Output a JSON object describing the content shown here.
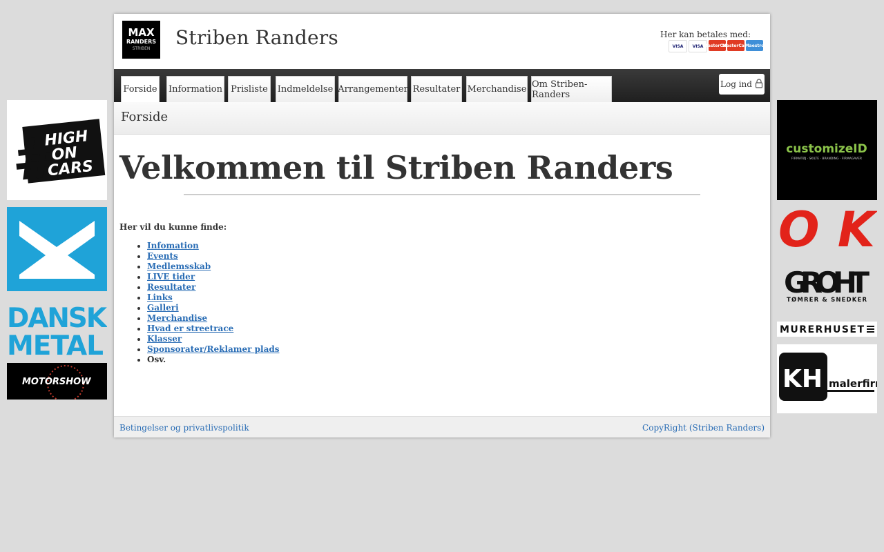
{
  "site": {
    "title": "Striben Randers",
    "logo_text": [
      "MAX",
      "RANDERS",
      "STRIBEN"
    ]
  },
  "payment": {
    "label": "Her kan betales med:",
    "cards": [
      {
        "name": "VISA",
        "bg": "#ffffff",
        "fg": "#1a1f71"
      },
      {
        "name": "VISA",
        "bg": "#ffffff",
        "fg": "#1a1f71"
      },
      {
        "name": "MasterCard",
        "bg": "#e03b24",
        "fg": "#ffffff"
      },
      {
        "name": "MasterCard",
        "bg": "#e03b24",
        "fg": "#ffffff"
      },
      {
        "name": "Maestro",
        "bg": "#3f8fd8",
        "fg": "#ffffff"
      }
    ]
  },
  "nav": {
    "tabs": [
      "Forside",
      "Information",
      "Prisliste",
      "Indmeldelse",
      "Arrangementer",
      "Resultater",
      "Merchandise",
      "Om Striben-Randers"
    ],
    "active": "Forside",
    "login_label": "Log ind",
    "login_icon": "lock-icon"
  },
  "breadcrumb": "Forside",
  "main": {
    "headline": "Velkommen til Striben Randers",
    "intro": "Her vil du kunne finde:",
    "links": [
      "Infomation",
      "Events",
      "Medlemsskab",
      "LIVE tider",
      "Resultater",
      "Links",
      "Galleri",
      "Merchandise",
      "Hvad er streetrace",
      "Klasser",
      "Sponsorater/Reklamer plads"
    ],
    "last_item": "Osv."
  },
  "footer": {
    "left_link": "Betingelser og privatlivspolitik",
    "right_link": "CopyRight (Striben Randers)"
  },
  "sponsors": {
    "left": [
      {
        "name": "high-on-cars",
        "lines": [
          "HIGH",
          "ON",
          "CARS"
        ],
        "bg": "#ffffff"
      },
      {
        "name": "dansk-metal",
        "lines": [
          "DANSK",
          "METAL"
        ],
        "color": "#1fa3d8"
      },
      {
        "name": "motorshow",
        "text": "MOTORSHOW",
        "bg": "#000000"
      }
    ],
    "right": [
      {
        "name": "customize-id",
        "text": "customizeID",
        "sub": "FIRMATØJ · SKILTE · BRANDING · FIRMAGAVER",
        "color": "#8bc34a"
      },
      {
        "name": "ok",
        "text": "OK",
        "color": "#e2231a"
      },
      {
        "name": "groht",
        "text": "GROHT",
        "sub": "TØMRER & SNEDKER"
      },
      {
        "name": "murerhuset",
        "text": "MURERHUSET"
      },
      {
        "name": "kh-malerfirma",
        "text": "KH",
        "sub": "malerfirma"
      }
    ]
  },
  "colors": {
    "link": "#2a6db5",
    "nav_bg": "#2b2b2b",
    "page_bg": "#dcdcdc"
  }
}
